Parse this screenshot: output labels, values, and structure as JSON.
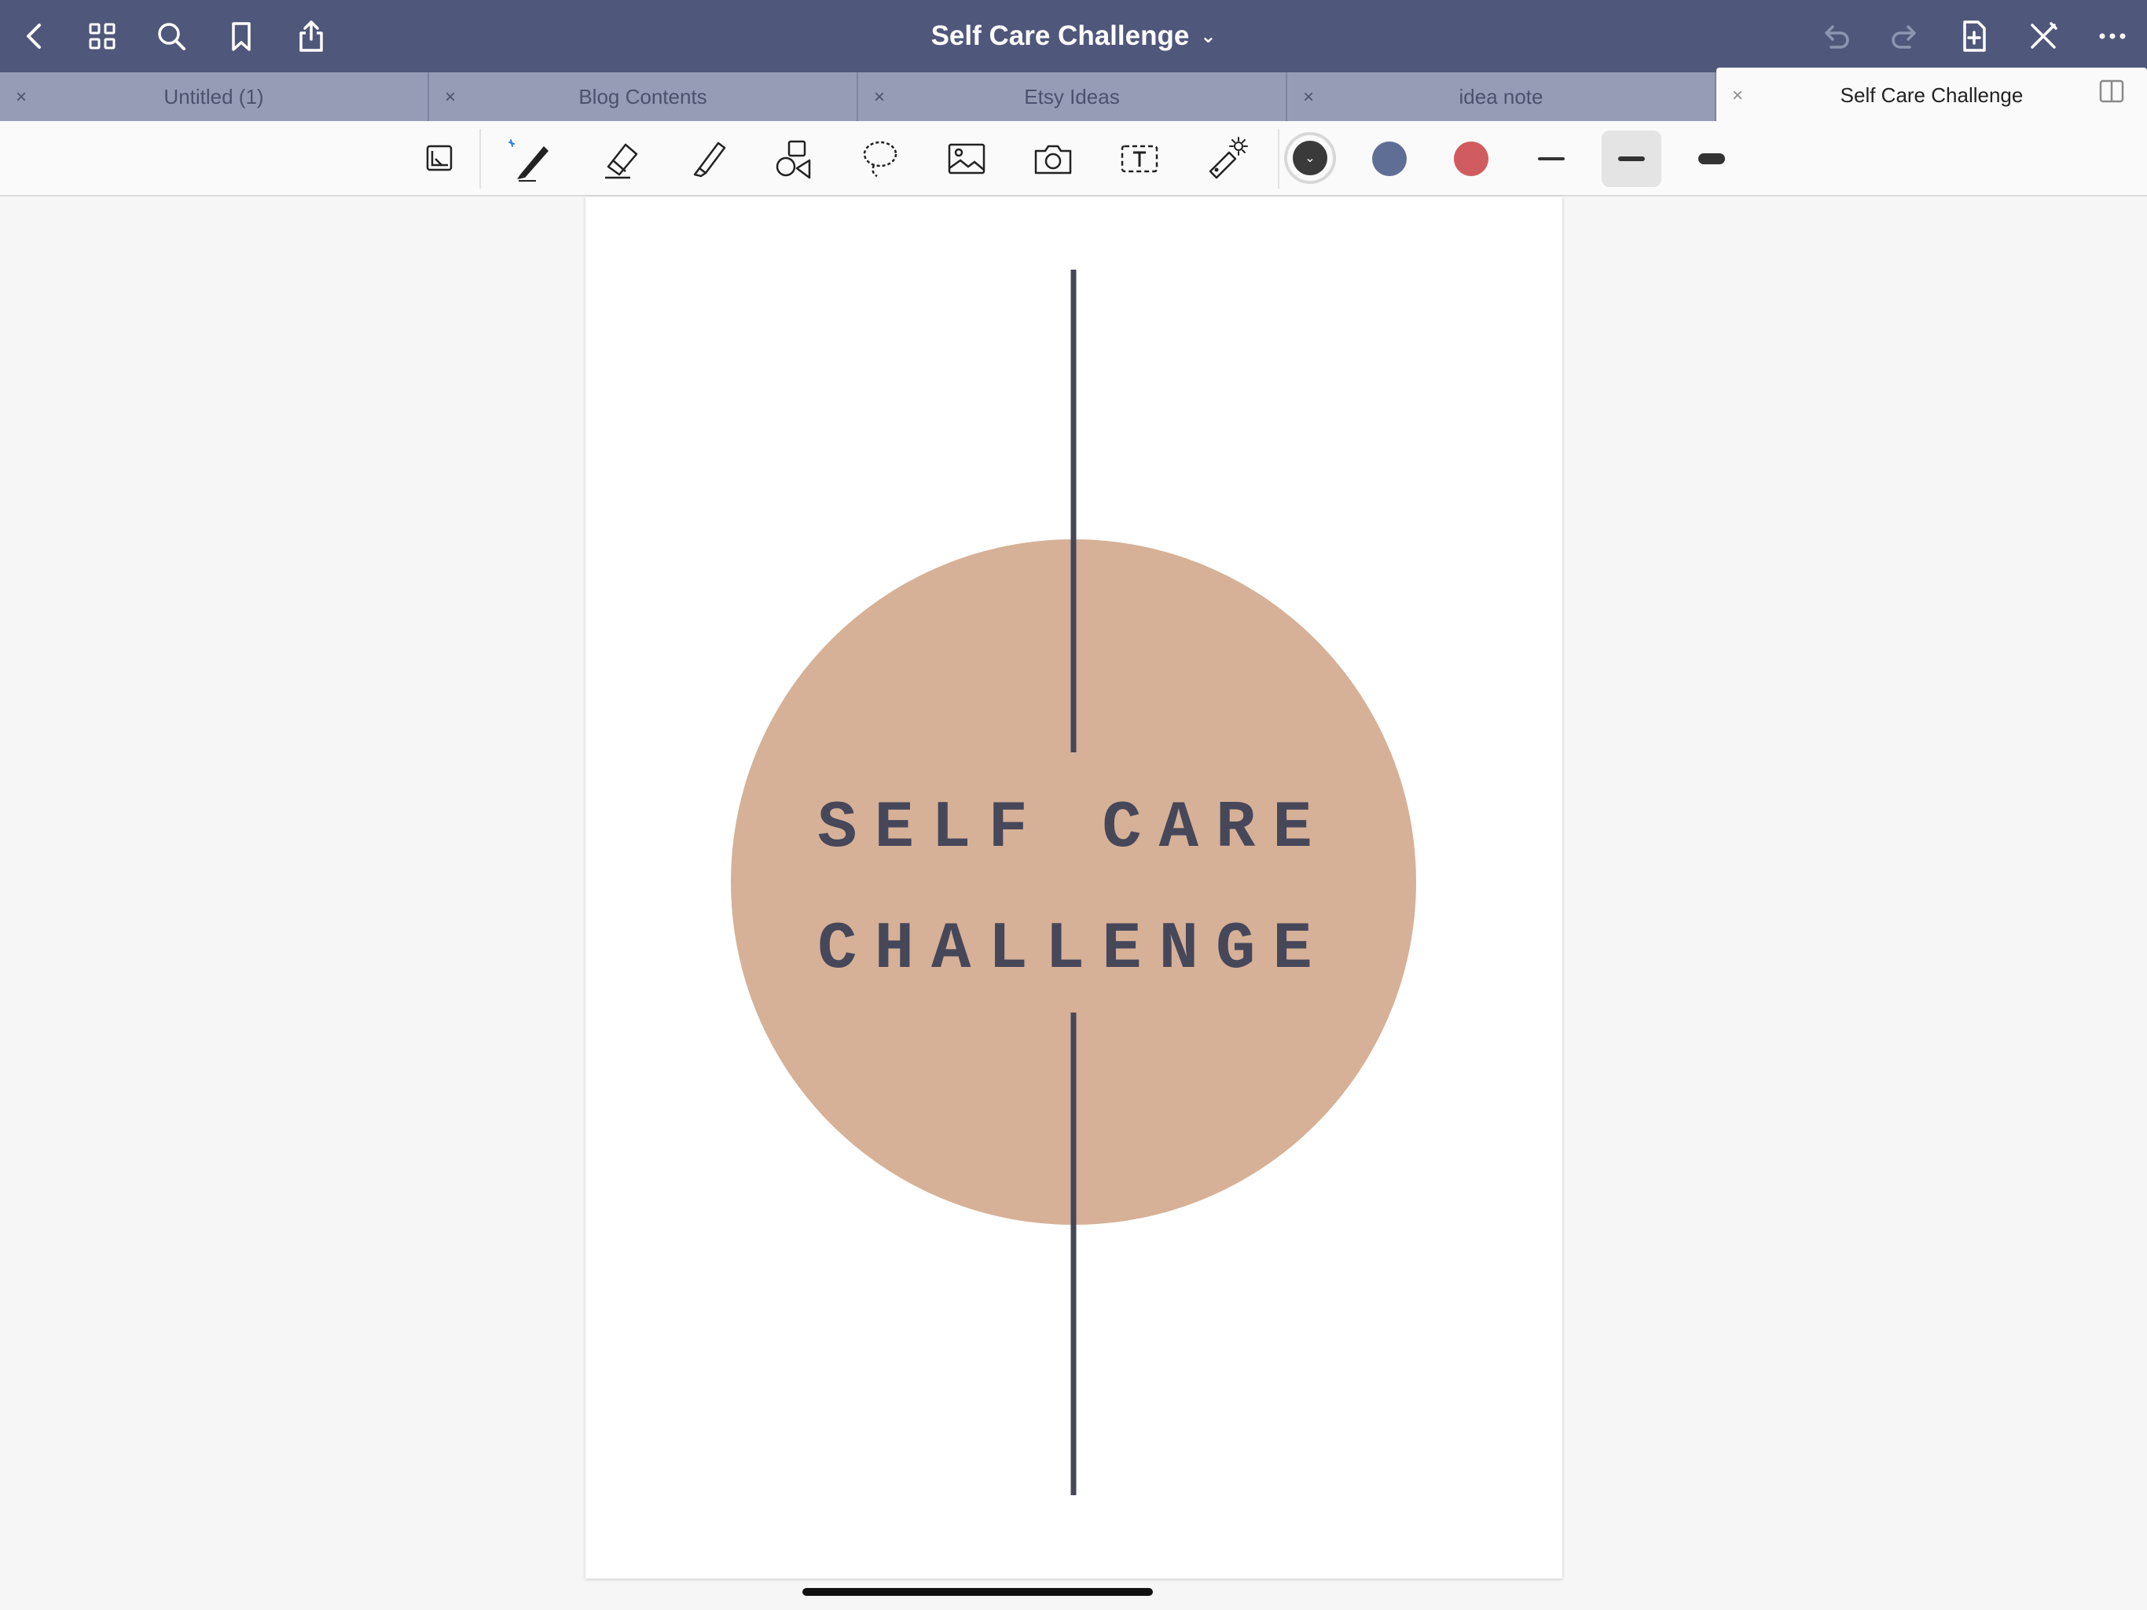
{
  "app": {
    "document_title": "Self Care Challenge",
    "title_chevron": "⌄"
  },
  "tabs": [
    {
      "label": "Untitled (1)",
      "close": "×",
      "active": false
    },
    {
      "label": "Blog Contents",
      "close": "×",
      "active": false
    },
    {
      "label": "Etsy Ideas",
      "close": "×",
      "active": false
    },
    {
      "label": "idea note",
      "close": "×",
      "active": false
    },
    {
      "label": "Self Care Challenge",
      "close": "×",
      "active": true
    }
  ],
  "toolbar": {
    "selected_tool": "pen",
    "colors": [
      "#3a3a3a",
      "#5f6e95",
      "#d05c5f"
    ],
    "selected_color_index": 0,
    "stroke_widths": [
      "thin",
      "medium",
      "thick"
    ],
    "selected_stroke_index": 1
  },
  "page": {
    "line1": "SELF CARE",
    "line2": "CHALLENGE",
    "circle_color": "#d6b197",
    "line_color": "#47475a",
    "text_color": "#47475a"
  }
}
